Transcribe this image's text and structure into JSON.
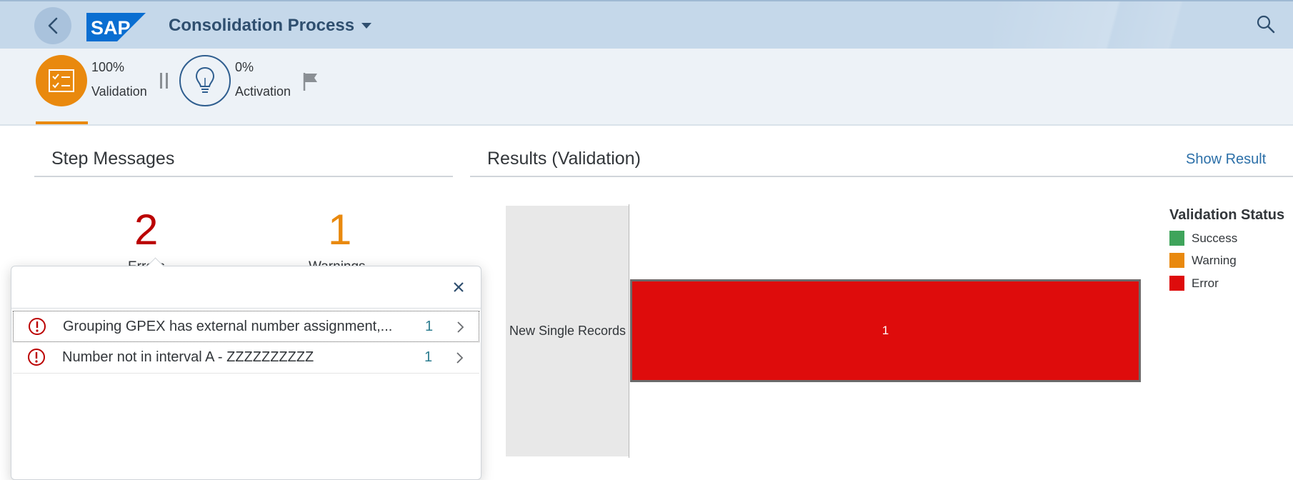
{
  "shell": {
    "logo_text": "SAP",
    "title": "Consolidation Process",
    "colors": {
      "bar": "#c5d8ea",
      "title": "#2f4f6f"
    }
  },
  "steps": [
    {
      "percent": "100%",
      "label": "Validation",
      "icon": "checklist-icon",
      "state": "active"
    },
    {
      "percent": "0%",
      "label": "Activation",
      "icon": "lightbulb-icon",
      "state": "pending"
    }
  ],
  "step_messages": {
    "title": "Step Messages",
    "errors": {
      "count": "2",
      "label": "Errors",
      "color": "#bb0000"
    },
    "warnings": {
      "count": "1",
      "label": "Warnings",
      "color": "#e9890e"
    }
  },
  "popover": {
    "messages": [
      {
        "text": "Grouping GPEX has external number assignment,...",
        "count": "1",
        "icon": "error-icon"
      },
      {
        "text": "Number not in interval A - ZZZZZZZZZZ",
        "count": "1",
        "icon": "error-icon"
      }
    ]
  },
  "results": {
    "title": "Results (Validation)",
    "show_result_label": "Show Result"
  },
  "chart_data": {
    "type": "bar",
    "orientation": "horizontal",
    "categories": [
      "New Single Records"
    ],
    "series": [
      {
        "name": "Success",
        "values": [
          0
        ],
        "color": "#3fa45b"
      },
      {
        "name": "Warning",
        "values": [
          0
        ],
        "color": "#e9890e"
      },
      {
        "name": "Error",
        "values": [
          1
        ],
        "color": "#de0c0c"
      }
    ],
    "data_labels": [
      "1"
    ],
    "legend_title": "Validation Status",
    "legend_position": "right",
    "xlim": [
      0,
      1
    ],
    "grid": false
  }
}
